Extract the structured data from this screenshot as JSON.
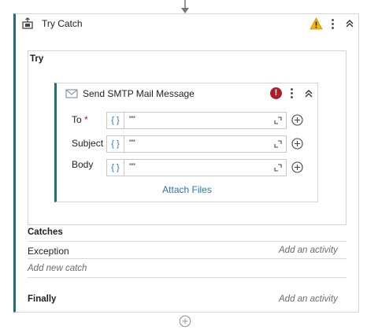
{
  "trycatch": {
    "title": "Try Catch",
    "try_label": "Try",
    "catches_label": "Catches",
    "exception_label": "Exception",
    "exception_placeholder": "Add an activity",
    "add_new_catch": "Add new catch",
    "finally_label": "Finally",
    "finally_placeholder": "Add an activity"
  },
  "smtp": {
    "title": "Send SMTP Mail Message",
    "error_glyph": "!",
    "fields": [
      {
        "label": "To",
        "required_mark": "*",
        "value": "\"\""
      },
      {
        "label": "Subject",
        "required_mark": "",
        "value": "\"\""
      },
      {
        "label": "Body",
        "required_mark": "",
        "value": "\"\""
      }
    ],
    "braces": "{ }",
    "attach_files": "Attach Files"
  },
  "colors": {
    "accent_bar": "#1d6f7a",
    "link": "#2c74b3",
    "error": "#b01d2a",
    "warning": "#f2b705"
  },
  "icons": [
    "arrow-down-icon",
    "try-catch-icon",
    "warning-icon",
    "kebab-menu-icon",
    "collapse-icon",
    "mail-icon",
    "error-icon",
    "expand-icon",
    "add-circle-icon"
  ]
}
